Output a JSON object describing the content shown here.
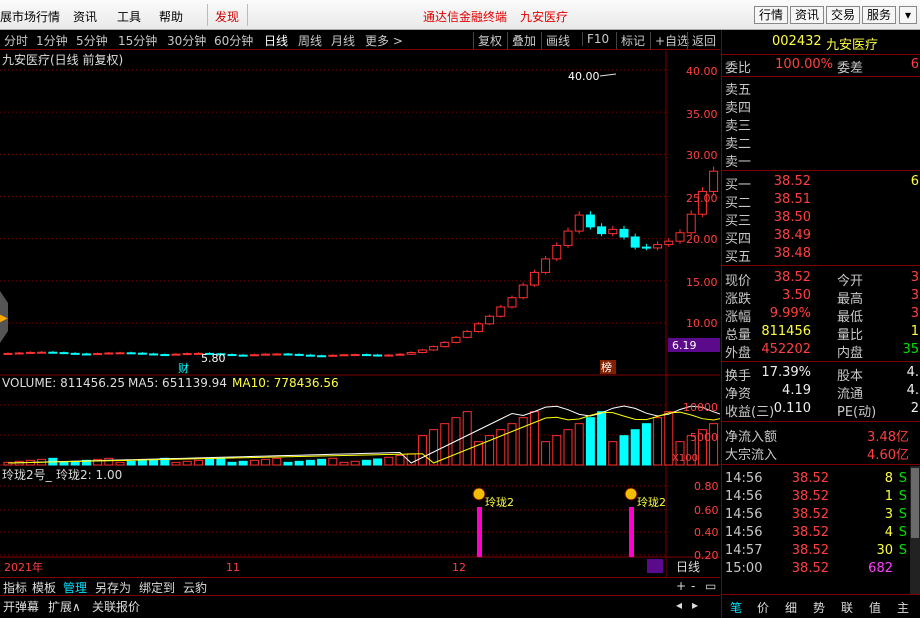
{
  "menubar": {
    "items": [
      "展市场行情",
      "资讯",
      "工具",
      "帮助"
    ],
    "discover": "发现",
    "terminal": "通达信金融终端",
    "stock_title": "九安医疗",
    "right_buttons": [
      "行情",
      "资讯",
      "交易",
      "服务"
    ]
  },
  "periods": [
    "分时",
    "1分钟",
    "5分钟",
    "15分钟",
    "30分钟",
    "60分钟",
    "日线",
    "周线",
    "月线",
    "更多 >"
  ],
  "tools": [
    "复权",
    "叠加",
    "画线",
    "F10",
    "标记",
    "+自选",
    "返回"
  ],
  "chart": {
    "title": "九安医疗(日线 前复权)",
    "high_label": "40.00",
    "low_label": "5.80",
    "price_axis": [
      "40.00",
      "35.00",
      "30.00",
      "25.00",
      "20.00",
      "15.00",
      "10.00"
    ],
    "current_price_tag": "6.19",
    "cai_label": "财",
    "bang_label": "榜",
    "volume_header": {
      "volume": "VOLUME: 811456.25",
      "ma5": "MA5: 651139.94",
      "ma10": "MA10: 778436.56"
    },
    "volume_axis": [
      "10000",
      "5000"
    ],
    "volume_unit": "X100",
    "ind_header": {
      "name": "玲珑2号_",
      "value": "玲珑2: 1.00"
    },
    "ind_axis": [
      "0.80",
      "0.60",
      "0.40",
      "0.20"
    ],
    "signal_label": "玲珑2",
    "date_labels": [
      "2021年",
      "11",
      "12"
    ],
    "period_label": "日线",
    "colors": {
      "up": "#ff3030",
      "down": "#00ffff",
      "ma5": "#ffffff",
      "ma10": "#ffff00",
      "signal": "#ff00cc"
    }
  },
  "bottom_tabs": [
    "指标",
    "模板",
    "管理",
    "另存为",
    "绑定到",
    "云豹"
  ],
  "status_bar": [
    "开弹幕",
    "扩展∧",
    "关联报价"
  ],
  "quote": {
    "code": "002432",
    "name": "九安医疗",
    "weibi_label": "委比",
    "weibi": "100.00%",
    "weicha_label": "委差",
    "weicha": "6",
    "sells": [
      "卖五",
      "卖四",
      "卖三",
      "卖二",
      "卖一"
    ],
    "buys": [
      {
        "label": "买一",
        "price": "38.52",
        "vol": "6"
      },
      {
        "label": "买二",
        "price": "38.51",
        "vol": ""
      },
      {
        "label": "买三",
        "price": "38.50",
        "vol": ""
      },
      {
        "label": "买四",
        "price": "38.49",
        "vol": ""
      },
      {
        "label": "买五",
        "price": "38.48",
        "vol": ""
      }
    ],
    "stats": [
      {
        "l": "现价",
        "v": "38.52",
        "l2": "今开",
        "v2": "3"
      },
      {
        "l": "涨跌",
        "v": "3.50",
        "l2": "最高",
        "v2": "3"
      },
      {
        "l": "涨幅",
        "v": "9.99%",
        "l2": "最低",
        "v2": "3"
      },
      {
        "l": "总量",
        "v": "811456",
        "l2": "量比",
        "v2": "1"
      },
      {
        "l": "外盘",
        "v": "452202",
        "l2": "内盘",
        "v2": "35"
      }
    ],
    "stats2": [
      {
        "l": "换手",
        "v": "17.39%",
        "l2": "股本",
        "v2": "4."
      },
      {
        "l": "净资",
        "v": "4.19",
        "l2": "流通",
        "v2": "4."
      },
      {
        "l": "收益(三)",
        "v": "0.110",
        "l2": "PE(动)",
        "v2": "2"
      }
    ],
    "flow": [
      {
        "l": "净流入额",
        "v": "3.48亿"
      },
      {
        "l": "大宗流入",
        "v": "4.60亿"
      }
    ],
    "ticks": [
      {
        "t": "14:56",
        "p": "38.52",
        "q": "8",
        "f": "S"
      },
      {
        "t": "14:56",
        "p": "38.52",
        "q": "1",
        "f": "S"
      },
      {
        "t": "14:56",
        "p": "38.52",
        "q": "3",
        "f": "S"
      },
      {
        "t": "14:56",
        "p": "38.52",
        "q": "4",
        "f": "S"
      },
      {
        "t": "14:57",
        "p": "38.52",
        "q": "30",
        "f": "S"
      },
      {
        "t": "15:00",
        "p": "38.52",
        "q": "682",
        "f": ""
      }
    ],
    "tabs": [
      "笔",
      "价",
      "细",
      "势",
      "联",
      "值",
      "主"
    ]
  }
}
